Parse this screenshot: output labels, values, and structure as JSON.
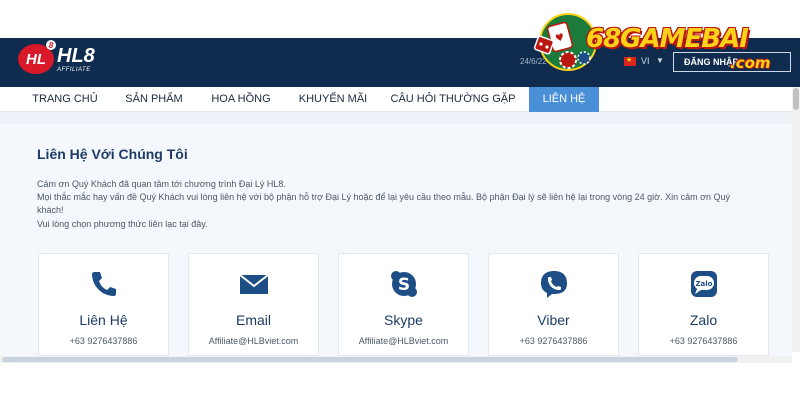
{
  "header": {
    "logo": "HL8",
    "logo_badge": "HL",
    "logo_badge_sup": "8",
    "logo_sub": "AFFILIATE",
    "date": "24/6/22 1",
    "language": "VI",
    "login_label": "ĐĂNG NHẬP"
  },
  "watermark": {
    "text": "68GAMEBAI",
    "suffix": ".com"
  },
  "nav": {
    "items": [
      {
        "label": "TRANG CHỦ"
      },
      {
        "label": "SẢN PHẨM"
      },
      {
        "label": "HOA HỒNG"
      },
      {
        "label": "KHUYẾN MÃI"
      },
      {
        "label": "CÂU HỎI THƯỜNG GẶP"
      },
      {
        "label": "LIÊN HỆ"
      }
    ],
    "active_index": 5
  },
  "main": {
    "title": "Liên Hệ Với Chúng Tôi",
    "para1": "Cảm ơn Quý Khách đã quan tâm tới chương trình Đại Lý HL8.",
    "para2": "Mọi thắc mắc hay vấn đề Quý Khách vui lòng liên hệ với bộ phận hỗ trợ Đại Lý hoặc để lại yêu cầu theo mẫu. Bộ phận Đại lý sẽ liên hệ lại trong vòng 24 giờ. Xin cảm ơn Quý",
    "para3": "khách!",
    "para4": "Vui lòng chọn phương thức liên lạc tại đây."
  },
  "cards": [
    {
      "title": "Liên Hệ",
      "value": "+63 9276437886",
      "icon": "phone-icon"
    },
    {
      "title": "Email",
      "value": "Affiliate@HLBviet.com",
      "icon": "envelope-icon"
    },
    {
      "title": "Skype",
      "value": "Affiliate@HLBviet.com",
      "icon": "skype-icon"
    },
    {
      "title": "Viber",
      "value": "+63 9276437886",
      "icon": "viber-icon"
    },
    {
      "title": "Zalo",
      "value": "+63 9276437886",
      "icon": "zalo-icon",
      "icon_text": "Zalo"
    }
  ],
  "colors": {
    "header_bg": "#0f2c4f",
    "nav_active": "#4a90d9",
    "brand_red": "#d7192a",
    "icon_blue": "#1d4f86",
    "title_text": "#1d3b66"
  }
}
